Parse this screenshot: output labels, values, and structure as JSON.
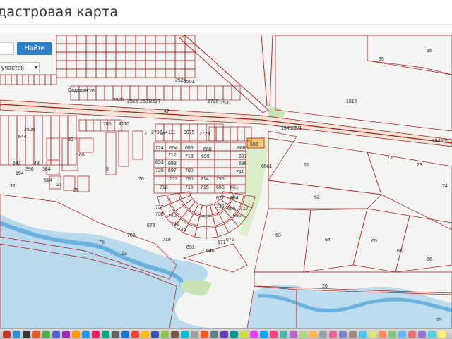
{
  "header": {
    "title": "дастровая карта"
  },
  "search": {
    "value": "",
    "button_label": "Найти"
  },
  "parcel_type": {
    "selected": "участок"
  },
  "map": {
    "colors": {
      "boundary": "#b01818",
      "water": "#6fb5e0",
      "highlight": "#f5c870",
      "vegetation": "#c9e3b5",
      "road": "#efe6d8"
    },
    "labels": [
      "154505/1",
      "154505",
      "47",
      "35",
      "35",
      "61",
      "62",
      "63",
      "64",
      "65",
      "66",
      "66",
      "73",
      "73",
      "74",
      "20",
      "25",
      "13",
      "Садовая ул",
      "658",
      "654",
      "655",
      "680",
      "724",
      "712",
      "713",
      "699",
      "653",
      "698",
      "697",
      "700",
      "725",
      "722",
      "756",
      "714",
      "715",
      "716",
      "717",
      "677",
      "736",
      "737",
      "738",
      "735",
      "650",
      "651",
      "664",
      "665",
      "690",
      "691",
      "646",
      "671",
      "672",
      "673",
      "719",
      "718",
      "740",
      "741",
      "745",
      "741",
      "686",
      "687",
      "688",
      "708",
      "75",
      "76",
      "705",
      "4110",
      "4111",
      "2707",
      "2729",
      "3075",
      "2720",
      "2531",
      "2537",
      "2527",
      "2528",
      "2525",
      "2524",
      "2501",
      "2505",
      "644",
      "643",
      "390",
      "164",
      "48",
      "384",
      "514",
      "21",
      "28",
      "32",
      "3",
      "30",
      "165",
      "2",
      "26",
      "6561",
      "1815"
    ]
  },
  "dock": {
    "icon_colors": [
      "#c8342a",
      "#2d8fd6",
      "#3a3a3a",
      "#e55b1f",
      "#4caf50",
      "#5560d6",
      "#9c27b0",
      "#ff9800",
      "#2196f3",
      "#e91e63",
      "#00a884",
      "#666666",
      "#1976d2",
      "#f44336",
      "#ffc107",
      "#3f51b5",
      "#8bc34a",
      "#795548",
      "#00bcd4",
      "#9e9e9e",
      "#ff5722",
      "#607d8b",
      "#673ab7",
      "#009688",
      "#cddc39",
      "#e040fb",
      "#03a9f4",
      "#ff4081",
      "#4db6ac",
      "#ba68c8",
      "#aed581",
      "#ffb74d",
      "#90a4ae",
      "#f06292",
      "#7986cb",
      "#a1887f",
      "#4fc3f7",
      "#dce775",
      "#ff8a65",
      "#81c784",
      "#64b5f6",
      "#e57373",
      "#9575cd",
      "#4dd0e1",
      "#fff176"
    ]
  }
}
